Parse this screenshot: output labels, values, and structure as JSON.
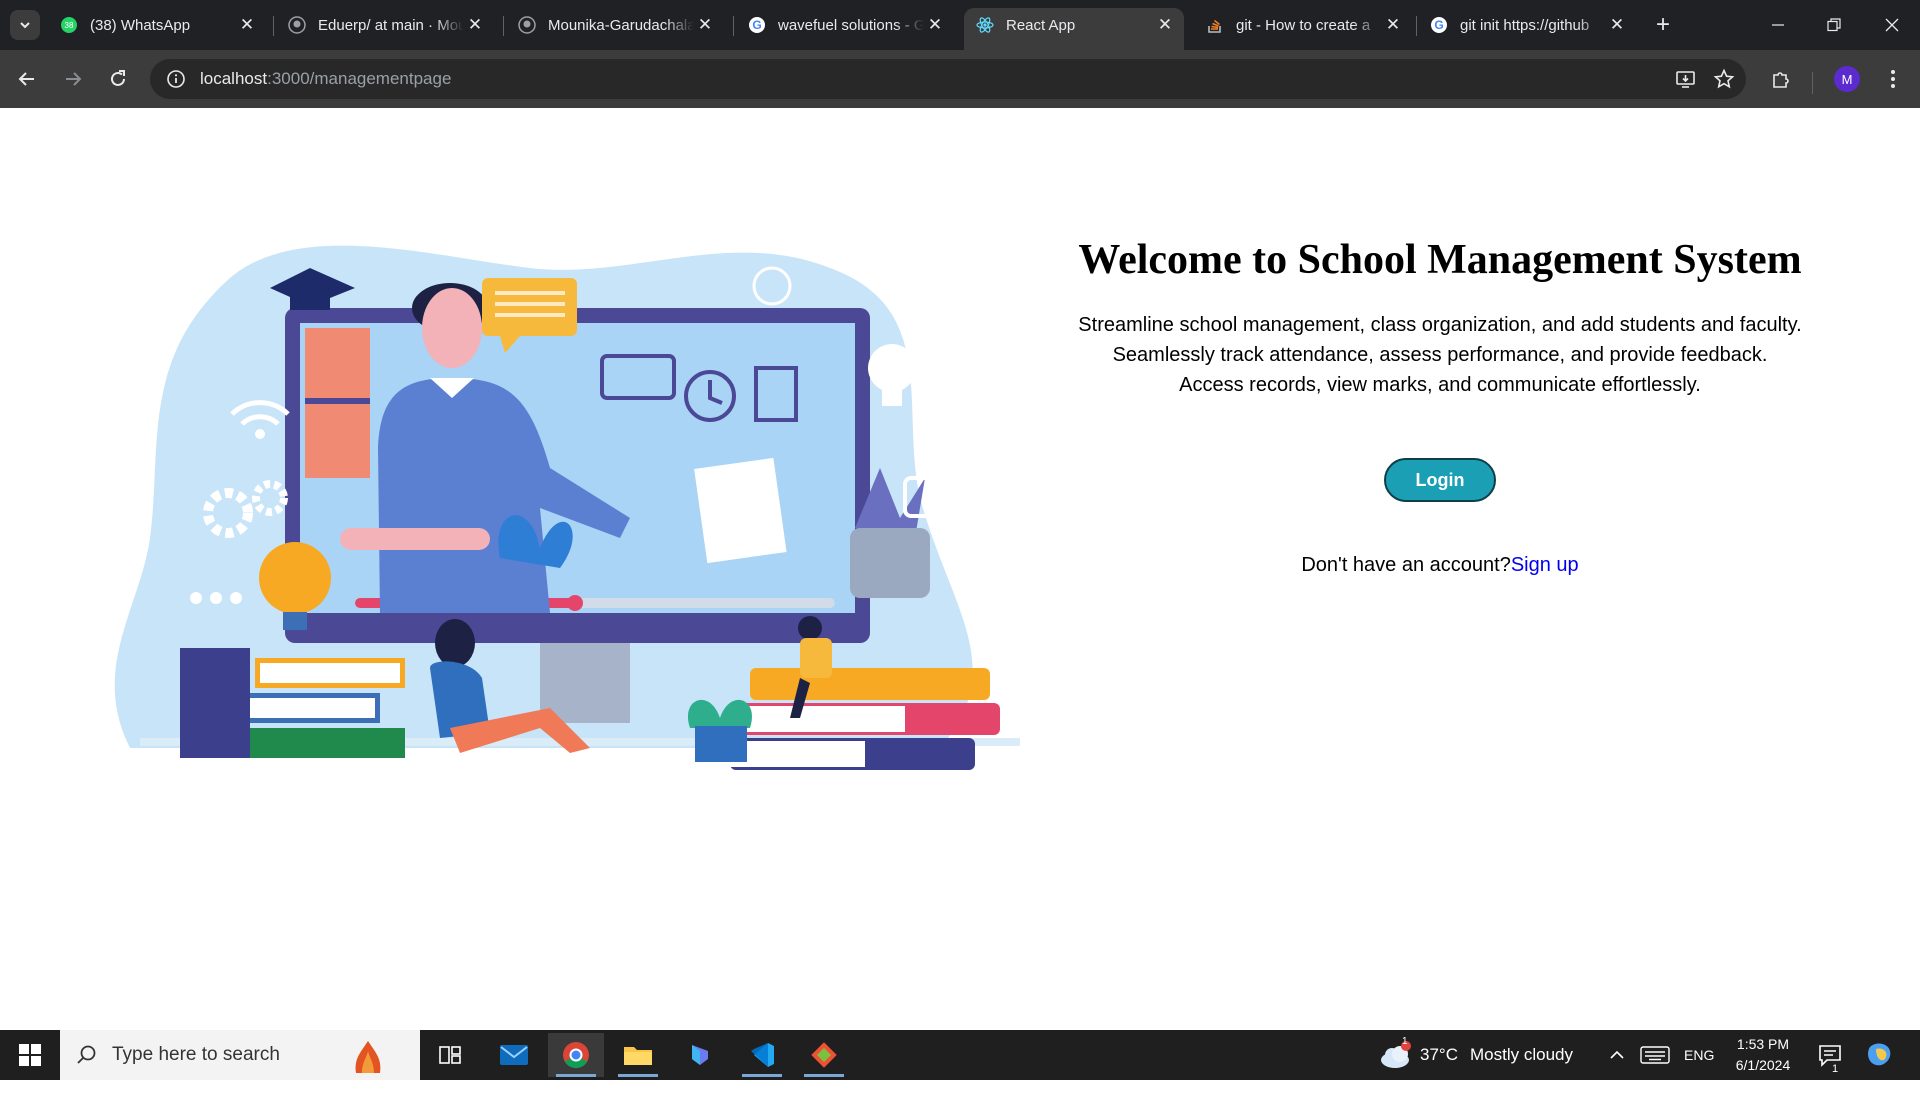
{
  "browser": {
    "tabs": [
      {
        "title": "(38) WhatsApp",
        "icon": "whatsapp-icon"
      },
      {
        "title": "Eduerp/ at main · Mounika",
        "icon": "github-icon"
      },
      {
        "title": "Mounika-Garudachala",
        "icon": "github-icon"
      },
      {
        "title": "wavefuel solutions - Google",
        "icon": "google-icon"
      },
      {
        "title": "React App",
        "icon": "react-icon"
      },
      {
        "title": "git - How to create a",
        "icon": "stackoverflow-icon"
      },
      {
        "title": "git init https://github",
        "icon": "google-icon"
      }
    ],
    "url_host": "localhost",
    "url_path": ":3000/managementpage",
    "profile_initial": "M"
  },
  "page": {
    "title": "Welcome to School Management System",
    "desc_lines": [
      "Streamline school management, class organization, and add students and faculty.",
      "Seamlessly track attendance, assess performance, and provide feedback.",
      "Access records, view marks, and communicate effortlessly."
    ],
    "login_label": "Login",
    "signup_prompt": "Don't have an account?",
    "signup_link": "Sign up"
  },
  "taskbar": {
    "search_placeholder": "Type here to search",
    "weather_temp": "37°C",
    "weather_desc": "Mostly cloudy",
    "weather_badge": "1",
    "lang": "ENG",
    "time": "1:53 PM",
    "date": "6/1/2024",
    "notif_count": "1"
  },
  "colors": {
    "login_bg": "#1a9fb5",
    "link": "#0000ee",
    "chrome_bg": "#202124",
    "toolbar_bg": "#3c3c3c"
  }
}
